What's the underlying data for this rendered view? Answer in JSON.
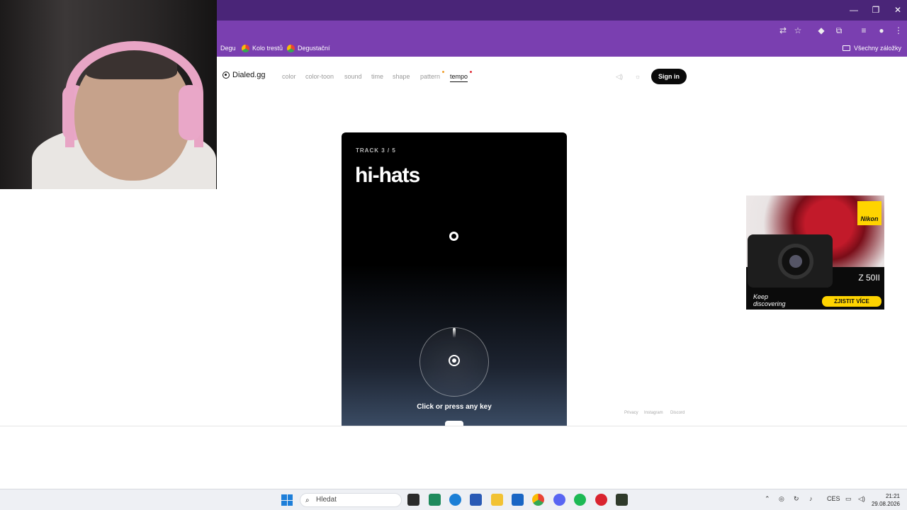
{
  "bookmarks": {
    "items": [
      "Degu",
      "Kolo trestů",
      "Degustační"
    ],
    "all_label": "Všechny záložky"
  },
  "nav": {
    "logo": "Dialed.gg",
    "links": [
      "color",
      "color-toon",
      "sound",
      "time",
      "shape",
      "pattern",
      "tempo"
    ],
    "active": "tempo",
    "signin": "Sign in"
  },
  "game": {
    "track": "TRACK 3 / 5",
    "title": "hi-hats",
    "hint": "Click or press any key"
  },
  "footer": {
    "links": [
      "Privacy",
      "Instagram",
      "Discord"
    ]
  },
  "ad": {
    "brand": "Nikon",
    "model": "Z 50II",
    "tagline_1": "Keep",
    "tagline_2": "discovering",
    "cta": "ZJISTIT VÍCE"
  },
  "taskbar": {
    "search_placeholder": "Hledat",
    "language": "CES",
    "time": "21:21",
    "date": "29.08.2026"
  },
  "colors": {
    "tabstrip": "#4a2578",
    "toolbar": "#7a3fb0",
    "accent_dot_orange": "#f0a030",
    "accent_dot_red": "#e0303a",
    "ad_yellow": "#ffd400"
  }
}
